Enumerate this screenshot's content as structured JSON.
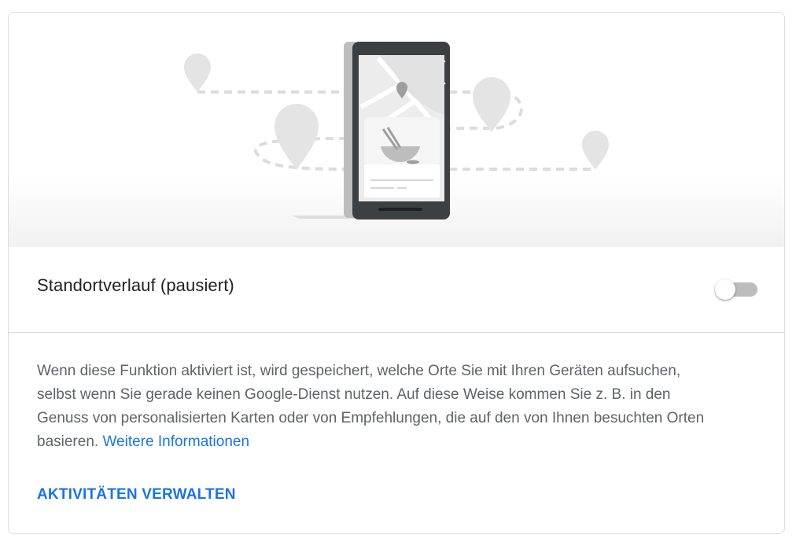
{
  "setting": {
    "title": "Standortverlauf (pausiert)",
    "enabled": false
  },
  "description": {
    "text": "Wenn diese Funktion aktiviert ist, wird gespeichert, welche Orte Sie mit Ihren Geräten aufsuchen, selbst wenn Sie gerade keinen Google-Dienst nutzen. Auf diese Weise kommen Sie z. B. in den Genuss von personalisierten Karten oder von Empfehlungen, die auf den von Ihnen besuchten Orten basieren. ",
    "link_label": "Weitere Informationen"
  },
  "actions": {
    "manage_label": "AKTIVITÄTEN VERWALTEN"
  },
  "colors": {
    "link": "#1a73e8",
    "toggle_track_off": "#bdbdbd",
    "divider": "#dadce0"
  }
}
